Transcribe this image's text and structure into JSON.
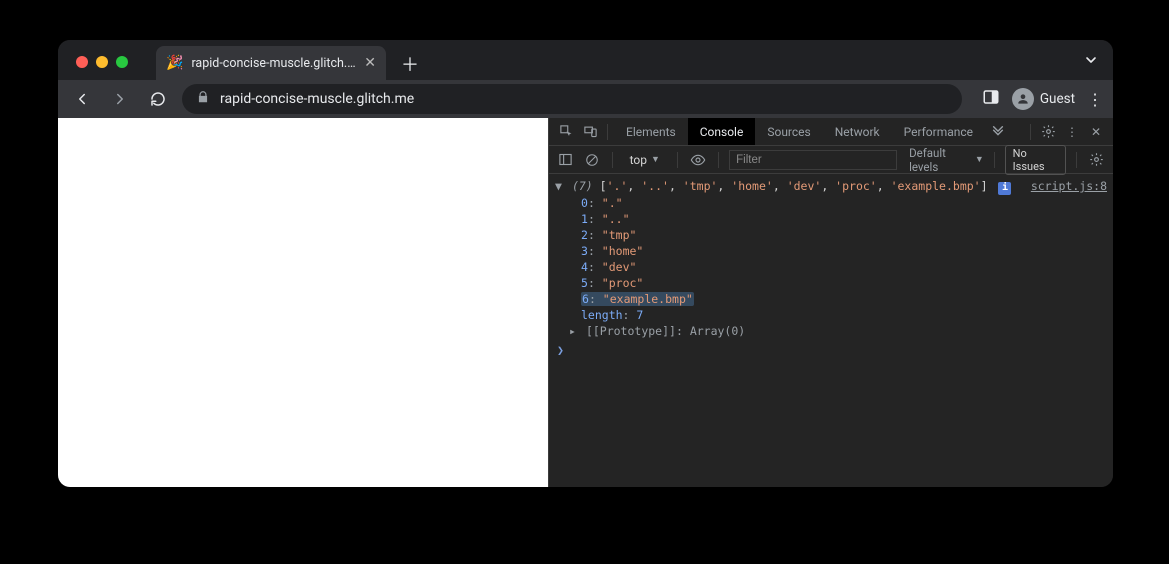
{
  "tab": {
    "title": "rapid-concise-muscle.glitch.me",
    "favicon": "🎉"
  },
  "url": "rapid-concise-muscle.glitch.me",
  "guest_label": "Guest",
  "devtools": {
    "tabs": [
      "Elements",
      "Console",
      "Sources",
      "Network",
      "Performance"
    ],
    "active": "Console"
  },
  "console": {
    "context": "top",
    "filter_placeholder": "Filter",
    "levels_label": "Default levels",
    "issues_label": "No Issues",
    "source": "script.js:8",
    "array_preview_count": "(7)",
    "array_items": [
      ".",
      "..",
      "tmp",
      "home",
      "dev",
      "proc",
      "example.bmp"
    ],
    "length_label": "length",
    "length_value": "7",
    "prototype_label": "[[Prototype]]",
    "prototype_value": "Array(0)",
    "highlighted_index": 6
  }
}
